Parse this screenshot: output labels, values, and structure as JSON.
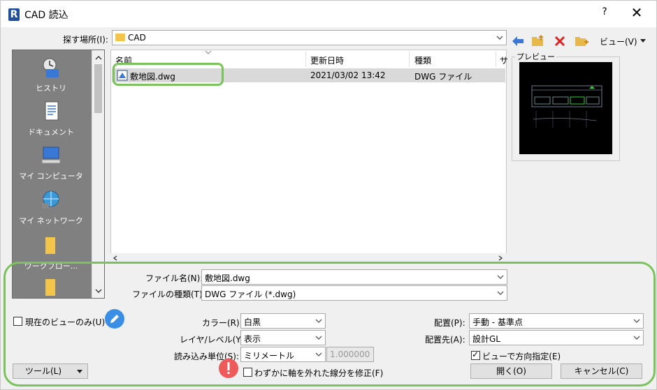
{
  "window": {
    "title": "CAD 読込",
    "icon_letter": "R",
    "help": "?",
    "close": "✕"
  },
  "lookin": {
    "label": "探す場所(I):",
    "value": "CAD"
  },
  "toolbar": {
    "view_label": "ビュー(V)"
  },
  "places": [
    {
      "label": "ヒストリ",
      "icon": "history-icon"
    },
    {
      "label": "ドキュメント",
      "icon": "documents-icon"
    },
    {
      "label": "マイ コンピュータ",
      "icon": "computer-icon"
    },
    {
      "label": "マイ ネットワーク",
      "icon": "network-icon"
    },
    {
      "label": "ワークフロー...",
      "icon": "folder-icon"
    },
    {
      "label": "",
      "icon": "folder-icon"
    }
  ],
  "filelist": {
    "columns": [
      "名前",
      "更新日時",
      "種類",
      "サ"
    ],
    "rows": [
      {
        "name": "敷地図.dwg",
        "modified": "2021/03/02 13:42",
        "type": "DWG ファイル"
      }
    ]
  },
  "preview": {
    "label": "プレビュー"
  },
  "form": {
    "filename_label": "ファイル名(N):",
    "filename_value": "敷地図.dwg",
    "filetype_label": "ファイルの種類(T):",
    "filetype_value": "DWG ファイル (*.dwg)",
    "current_view_label": "現在のビューのみ(U)",
    "color_label": "カラー(R):",
    "color_value": "白黒",
    "layer_label": "レイヤ/レベル(Y):",
    "layer_value": "表示",
    "units_label": "読み込み単位(S):",
    "units_value": "ミリメートル",
    "units_scale": "1.000000",
    "fix_lines_label": "わずかに軸を外れた線分を修正(F)",
    "placement_label": "配置(P):",
    "placement_value": "手動 - 基準点",
    "placeat_label": "配置先(A):",
    "placeat_value": "設計GL",
    "orient_label": "ビューで方向指定(E)",
    "tools_label": "ツール(L)",
    "open_label": "開く(O)",
    "cancel_label": "キャンセル(C)"
  }
}
